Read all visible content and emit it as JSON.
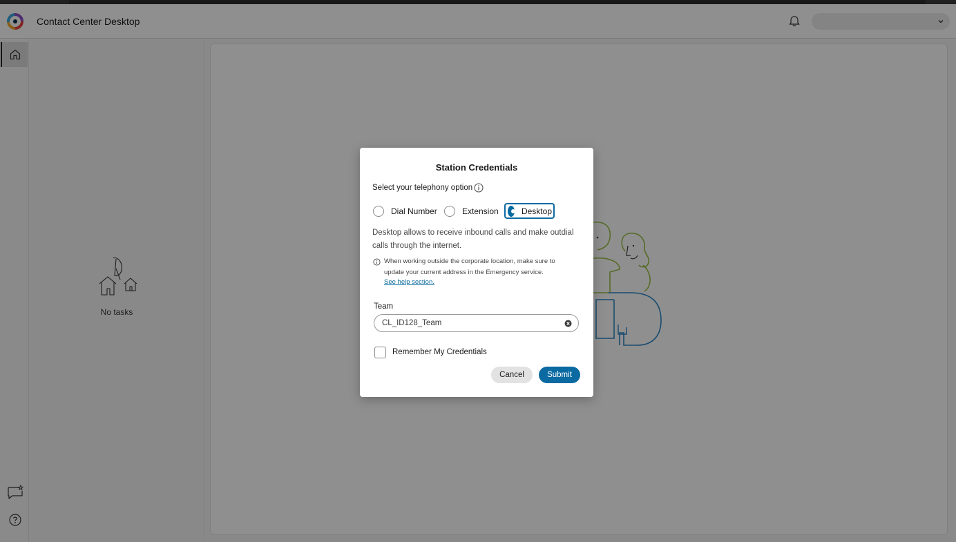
{
  "app": {
    "title": "Contact Center Desktop"
  },
  "header": {
    "user_menu_value": ""
  },
  "icons": {
    "logo": "webex-contact-center-logo",
    "notifications": "bell-icon",
    "user_menu": "chevron-down-icon",
    "nav_home": "home-icon",
    "nav_feedback": "feedback-icon",
    "nav_help": "help-icon",
    "empty_tasks": "gramophone-illustration",
    "info": "info-icon",
    "clear": "clear-icon"
  },
  "task_panel": {
    "empty_text": "No tasks"
  },
  "modal": {
    "title": "Station Credentials",
    "telephony_label": "Select your telephony option",
    "options": [
      {
        "label": "Dial Number",
        "selected": false
      },
      {
        "label": "Extension",
        "selected": false
      },
      {
        "label": "Desktop",
        "selected": true
      }
    ],
    "description": "Desktop allows to receive inbound calls and make outdial calls through the internet.",
    "note": "When working outside the corporate location, make sure to update your current address in the Emergency service.",
    "help_link": "See help section.",
    "team": {
      "label": "Team",
      "value": "CL_ID128_Team"
    },
    "remember": {
      "label": "Remember My Credentials",
      "checked": false
    },
    "buttons": {
      "cancel": "Cancel",
      "submit": "Submit"
    }
  },
  "colors": {
    "accent": "#0b6aa1",
    "overlay": "rgba(0,0,0,0.44)",
    "illustration_green": "#9bbf4a",
    "illustration_blue": "#2b86c5"
  }
}
